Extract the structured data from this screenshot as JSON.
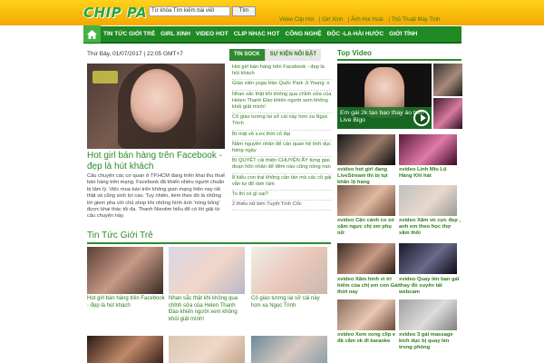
{
  "header": {
    "logo": "CHIP PA",
    "search_placeholder": "Từ khóa Tìm kiếm bài viết",
    "search_button": "Tìm",
    "top_links": [
      "Video Clip Hot",
      "| Girl Xinh",
      "| Ảnh Hot Hoài",
      "| Thủ Thuật Máy Tính"
    ]
  },
  "nav": {
    "items": [
      "TIN TỨC GIỚI TRẺ",
      "GIRL XINH",
      "VIDEO HOT",
      "CLIP NHẠC HOT",
      "CÔNG NGHỆ",
      "ĐỘC -LẠ-HÀI HƯỚC",
      "GIỚI TÍNH"
    ]
  },
  "date": "Thứ Bảy, 01/07/2017 | 22:05 GMT+7",
  "tabs": [
    "TIN SOCK",
    "SỰ KIỆN NỔI BẬT"
  ],
  "featured": {
    "title": "Hot girl bán hàng trên Facebook - đẹp là hút khách",
    "desc": "Câu chuyện các cơ quan ở TP.HCM đang triển khai thu thuế bán hàng trên mạng. Facebook đã khiến nhiều người chuẩn bị tâm lý. Việc mua bán trên không gian mạng hiện nay rất thật và cũng sinh lợi cao. Tuy nhiên, kèm theo đó là những lời giem pha với chủ shop khi những hình ảnh 'nóng bỏng' được khai thác tối đa. Thanh Nientim hiểu để có lời giải từ câu chuyện này."
  },
  "news": [
    "Hot girl bán hàng trên Facebook - đẹp là hút khách",
    "Giáo viên yoga Hàn Quốc Park Ji Young :x",
    "Nhan sắc thật khi không qua chỉnh sửa của Helen Thanh Đào khiến người xem không khỏi giật mình!",
    "Cô giáo tương lai sở cái này hơn xa Ngọc Trinh",
    "Bí mật về s.ex thời cổ đại",
    "Năm nguyên nhân để cản quan hệ tình dục hàng ngày",
    "Bí QUYẾT cải thiện CHUYỆN ẤY từng giai đoạn hôn nhân để đêm nào cũng nồng nàn",
    "8 kiểu con trai không cần tán mà các cô gái vẫn tự đổ rầm rầm",
    "To thì có gì sai?",
    "2 thiếu nữ bên Tuyệt Tình Cốc"
  ],
  "section": {
    "title": "Tin Tức Giới Trẻ",
    "items": [
      "Hot girl bán hàng trên Facebook - đẹp là hút khách",
      "Nhan sắc thật khi không qua chỉnh sửa của Helen Thanh Đào khiến người xem không khỏi giật mình!",
      "Cô giáo tương lai sở cái này hơn xa Ngọc Trinh"
    ]
  },
  "sidebar": {
    "title": "Top Video",
    "main_caption": "Em gái 2k tạo bạo thay áo trên Live Bigo",
    "items": [
      "xvideo hot girl đang LiveStream thì bị tụt khăn lộ hàng",
      "xvideo Linh Miu Lộ Hàng Khi hát",
      "xvideo Cận cảnh co sò xăm ngực chị em phụ nữ",
      "xvideo Xăm vú cực đẹp , anh em theo học thợ xăm thôi",
      "xvideo Xăm hình vì tri hiểm của chị em con Gái thời nay",
      "xvideo Quay lén bạn gái thay đồ xuyên tất webcam",
      "xvideo Xem xong clip e đã cắm vk đi karaoke",
      "xvideo 3 gái massage kich dục bị quay lén trong phòng"
    ]
  },
  "colors": {
    "brand_green": "#2e8b2e",
    "header_yellow": "#ffd21a",
    "nav_green": "#1f8a24"
  }
}
